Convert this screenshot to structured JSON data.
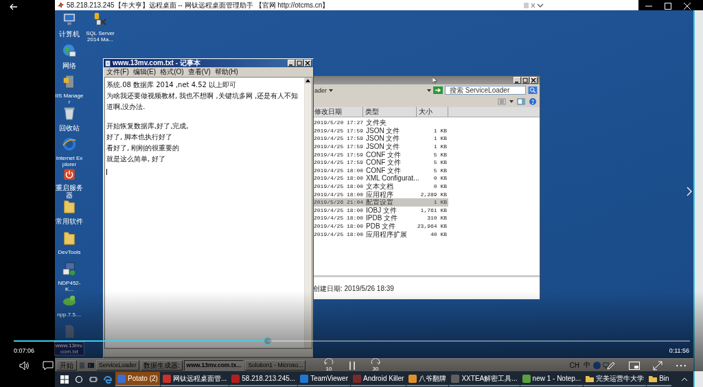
{
  "remote_window": {
    "title": "58.218.213.245【牛大亨】远程桌面 -- 网钛远程桌面管理助手 【官网 http://otcms.cn】"
  },
  "desktop_icons": [
    {
      "label": "计算机",
      "kind": "computer",
      "selected": false
    },
    {
      "label": "网络",
      "kind": "network",
      "selected": false
    },
    {
      "label": "IIS Manager",
      "kind": "server",
      "selected": false
    },
    {
      "label": "回收站",
      "kind": "recycle",
      "selected": false
    },
    {
      "label": "Internet Explorer",
      "kind": "browser",
      "selected": false
    },
    {
      "label": "重启服务器",
      "kind": "restart",
      "selected": false
    },
    {
      "label": "常用软件",
      "kind": "folder",
      "selected": false
    },
    {
      "label": "DevTools",
      "kind": "folder",
      "selected": false
    },
    {
      "label": "NDP452-K...",
      "kind": "installer",
      "selected": false
    },
    {
      "label": "npp.7.5....",
      "kind": "chameleon",
      "selected": false
    },
    {
      "label": "www.13mv.com.txt",
      "kind": "textfile",
      "selected": true
    },
    {
      "label": "SQL Server 2014 Ma...",
      "kind": "database",
      "selected": false
    }
  ],
  "notepad": {
    "title": "www.13mv.com.txt - 记事本",
    "menu": [
      "文件(F)",
      "编辑(E)",
      "格式(O)",
      "查看(V)",
      "帮助(H)"
    ],
    "paragraphs": [
      [
        "系统.08 数据库 2014 ,net 4.52 以上即可",
        "为啥我还要做视频教材, 我也不想啊 ,关键坑多网 ,还是有人不知道啊,没办法."
      ],
      [
        "开始恢复数据库,好了,完成,",
        "好了, 脚本也执行好了",
        "看好了, 刚刚的很重要的",
        "就是这么简单, 好了"
      ]
    ]
  },
  "explorer": {
    "address": "ader",
    "search": {
      "placeholder": "搜索 ServiceLoader"
    },
    "columns": [
      "修改日期",
      "类型",
      "大小"
    ],
    "rows": [
      {
        "date": "2019/5/20 17:27",
        "type": "文件夹",
        "selected": false
      },
      {
        "date": "2019/4/25 17:59",
        "type": "JSON 文件",
        "size": "1 KB",
        "selected": false
      },
      {
        "date": "2019/4/25 17:59",
        "type": "JSON 文件",
        "size": "1 KB",
        "selected": false
      },
      {
        "date": "2019/4/25 17:59",
        "type": "JSON 文件",
        "size": "1 KB",
        "selected": false
      },
      {
        "date": "2019/4/25 17:59",
        "type": "CONF 文件",
        "size": "5 KB",
        "selected": false
      },
      {
        "date": "2019/4/25 17:59",
        "type": "CONF 文件",
        "size": "5 KB",
        "selected": false
      },
      {
        "date": "2019/4/25 18:00",
        "type": "CONF 文件",
        "size": "5 KB",
        "selected": false
      },
      {
        "date": "2019/4/25 18:00",
        "type": "XML Configurat...",
        "size": "0 KB",
        "selected": false
      },
      {
        "date": "2019/4/25 18:00",
        "type": "文本文档",
        "size": "0 KB",
        "selected": false
      },
      {
        "date": "2019/4/25 18:00",
        "type": "应用程序",
        "size": "2,289 KB",
        "selected": false
      },
      {
        "date": "2019/5/26 21:04",
        "type": "配置设置",
        "size": "1 KB",
        "selected": true
      },
      {
        "date": "2019/4/25 18:00",
        "type": "IOBJ 文件",
        "size": "1,761 KB",
        "selected": false
      },
      {
        "date": "2019/4/25 18:00",
        "type": "IPDB 文件",
        "size": "310 KB",
        "selected": false
      },
      {
        "date": "2019/4/25 18:00",
        "type": "PDB 文件",
        "size": "23,964 KB",
        "selected": false
      },
      {
        "date": "2019/4/25 18:00",
        "type": "应用程序扩展",
        "size": "40 KB",
        "selected": false
      }
    ],
    "status": "创建日期: 2019/5/26 18:39"
  },
  "remote_taskbar": {
    "start": "开始",
    "items": [
      {
        "label": "ServiceLoader",
        "selected": false
      },
      {
        "label": "数据生成器:",
        "selected": false
      },
      {
        "label": "www.13mv.com.tx...",
        "selected": true
      },
      {
        "label": "Solution1 - Microso...",
        "selected": false
      }
    ],
    "tray": [
      "CH",
      "中"
    ]
  },
  "local_taskbar": {
    "items": [
      {
        "label": "Potato (2)",
        "kind": "app",
        "color": "#3b6fd8",
        "selected": true
      },
      {
        "label": "网钛远程桌面管...",
        "kind": "app",
        "color": "#c8322a",
        "selected": false
      },
      {
        "label": "58.218.213.245...",
        "kind": "app",
        "color": "#b02020",
        "selected": false
      },
      {
        "label": "TeamViewer",
        "kind": "app",
        "color": "#1e78d2",
        "selected": false
      },
      {
        "label": "Android Killer",
        "kind": "app",
        "color": "#7a2a2a",
        "selected": false
      },
      {
        "label": "八爷翻牌",
        "kind": "app",
        "color": "#e0902a",
        "selected": false
      },
      {
        "label": "XXTEA解密工具...",
        "kind": "app",
        "color": "#606060",
        "selected": false
      },
      {
        "label": "new 1 - Notep...",
        "kind": "app",
        "color": "#5aa040",
        "selected": false
      },
      {
        "label": "完美运营牛大学",
        "kind": "folder",
        "color": "#e8c050",
        "selected": false
      },
      {
        "label": "Bin",
        "kind": "folder",
        "color": "#e8c050",
        "selected": false
      }
    ]
  },
  "player": {
    "elapsed": "0:07:06",
    "duration": "0:11:56",
    "progress": {
      "level": 0.376
    },
    "skip_back": "10",
    "skip_forward": "30"
  }
}
